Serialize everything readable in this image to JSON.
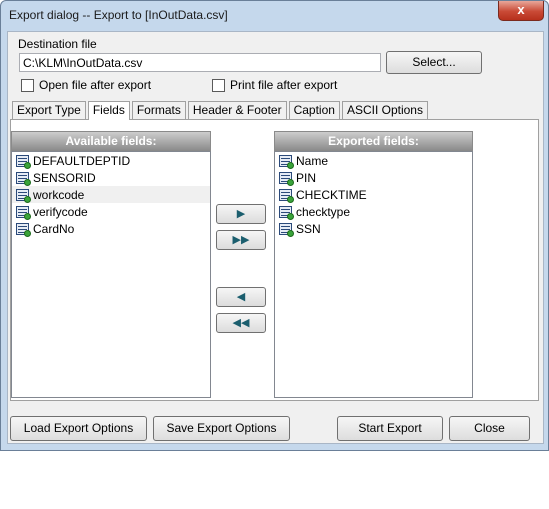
{
  "window": {
    "title": "Export dialog -- Export to [InOutData.csv]",
    "close_label": "x"
  },
  "destination": {
    "label": "Destination file",
    "value": "C:\\KLM\\InOutData.csv",
    "select_label": "Select..."
  },
  "options": {
    "open_after": "Open file after export",
    "print_after": "Print file after export"
  },
  "tabs": [
    {
      "label": "Export Type"
    },
    {
      "label": "Fields"
    },
    {
      "label": "Formats"
    },
    {
      "label": "Header & Footer"
    },
    {
      "label": "Caption"
    },
    {
      "label": "ASCII Options"
    }
  ],
  "available": {
    "header": "Available fields:",
    "items": [
      "DEFAULTDEPTID",
      "SENSORID",
      "workcode",
      "verifycode",
      "CardNo"
    ]
  },
  "exported": {
    "header": "Exported fields:",
    "items": [
      "Name",
      "PIN",
      "CHECKTIME",
      "checktype",
      "SSN"
    ]
  },
  "arrows": {
    "add_one": "▶",
    "add_all": "▶▶",
    "remove_one": "◀",
    "remove_all": "◀◀"
  },
  "footer": {
    "load": "Load Export Options",
    "save": "Save Export Options",
    "start": "Start Export",
    "close": "Close"
  }
}
